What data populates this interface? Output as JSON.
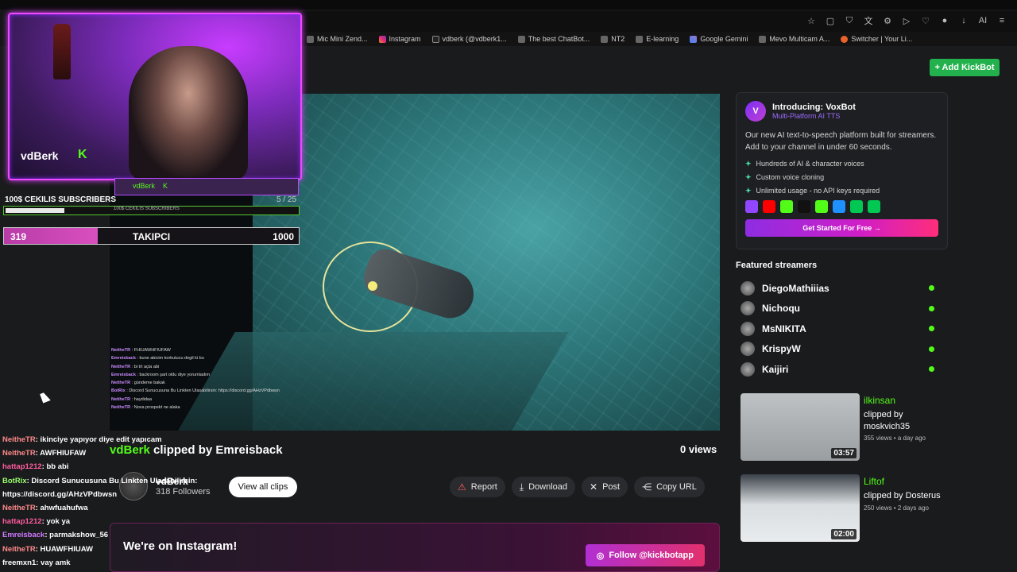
{
  "browser": {
    "bookmarks": [
      {
        "label": "Mic Mini Zend...",
        "icon": "generic"
      },
      {
        "label": "Instagram",
        "icon": "instagram"
      },
      {
        "label": "vdberk (@vdberk1...",
        "icon": "tiktok"
      },
      {
        "label": "The best ChatBot...",
        "icon": "generic"
      },
      {
        "label": "NT2",
        "icon": "generic"
      },
      {
        "label": "E-learning",
        "icon": "generic"
      },
      {
        "label": "Google Gemini",
        "icon": "gemini"
      },
      {
        "label": "Mevo Multicam A...",
        "icon": "generic"
      },
      {
        "label": "Switcher | Your Li...",
        "icon": "switcher"
      }
    ],
    "toolbar_ai_label": "AI"
  },
  "header": {
    "add_kickbot_label": "+ Add KickBot"
  },
  "clip": {
    "channel": "vdBerk",
    "clipped_by_text": "clipped by Emreisback",
    "views": "0 views",
    "channel_name": "vdBerk",
    "followers": "318 Followers",
    "view_all_label": "View all clips",
    "actions": {
      "report": "Report",
      "download": "Download",
      "post": "Post",
      "copy_url": "Copy URL"
    }
  },
  "promo": {
    "title": "We're on Instagram!",
    "follow_label": "Follow @kickbotapp"
  },
  "voxbot": {
    "logo": "V",
    "title": "Introducing: VoxBot",
    "subtitle": "Multi-Platform AI TTS",
    "description": "Our new AI text-to-speech platform built for streamers. Add to your channel in under 60 seconds.",
    "features": [
      "Hundreds of AI & character voices",
      "Custom voice cloning",
      "Unlimited usage - no API keys required"
    ],
    "cta": "Get Started For Free →",
    "platform_colors": [
      "#9146ff",
      "#ff0000",
      "#53fc18",
      "#111111",
      "#53fc18",
      "#1e90ff",
      "#00c853",
      "#00c853"
    ]
  },
  "featured": {
    "title": "Featured streamers",
    "streamers": [
      "DiegoMathiiias",
      "Nichoqu",
      "MsNIKITA",
      "KrispyW",
      "Kaijiri"
    ]
  },
  "clips": [
    {
      "channel": "ilkinsan",
      "by": "clipped by moskvich35",
      "meta": "355 views • a day ago",
      "duration": "03:57"
    },
    {
      "channel": "Liftof",
      "by": "clipped by Dosterus",
      "meta": "250 views • 2 days ago",
      "duration": "02:00"
    }
  ],
  "overlay": {
    "cam_name": "vdBerk",
    "mini_cam_name": "vdBerk",
    "subs_label": "100$ CEKILIS SUBSCRIBERS",
    "subs_count": "5 / 25",
    "subs_inner": "100$ CEKILIS SUBSCRIBERS",
    "subs_progress": 0.2,
    "follow_current": "319",
    "follow_label": "TAKIPCI",
    "follow_goal": "1000",
    "follow_progress": 0.319
  },
  "video_chat": [
    {
      "user": "NeitheTR",
      "msg": ": FHIUAWHFIUFAW"
    },
    {
      "user": "Emreisback",
      "msg": ": bune abicim korkutucu degil ki bu"
    },
    {
      "user": "NeitheTR",
      "msg": ": bi trt açta abi"
    },
    {
      "user": "Emreisback",
      "msg": ": backroom şart oldu diye yorumladım"
    },
    {
      "user": "NeitheTR",
      "msg": ": gündeme bakak"
    },
    {
      "user": "BotRix",
      "msg": ": Discord Sunucusuna Bu Linkten Ulasabilirsin: https://discord.gg/AHzVPdbwsn"
    },
    {
      "user": "NeitheTR",
      "msg": ": haydidaa"
    },
    {
      "user": "NeitheTR",
      "msg": ": Nova prospekt ne alaka"
    }
  ],
  "chat": [
    {
      "user": "NeitheTR",
      "msg": ": ikinciye yapıyor diye edit yapıcam",
      "cls": "u1"
    },
    {
      "user": "NeitheTR",
      "msg": ": AWFHIUFAW",
      "cls": "u1"
    },
    {
      "user": "hattap1212",
      "msg": ": bb abi",
      "cls": "u2"
    },
    {
      "user": "BotRix",
      "msg": ": Discord Sunucusuna Bu Linkten Ulasabilirsin:",
      "cls": "u3"
    },
    {
      "user": "",
      "msg": "https://discord.gg/AHzVPdbwsn",
      "cls": "u5"
    },
    {
      "user": "NeitheTR",
      "msg": ": ahwfuahufwa",
      "cls": "u1"
    },
    {
      "user": "hattap1212",
      "msg": ": yok ya",
      "cls": "u2"
    },
    {
      "user": "Emreisback",
      "msg": ": parmakshow_56",
      "cls": "u4"
    },
    {
      "user": "NeitheTR",
      "msg": ": HUAWFHIUAW",
      "cls": "u1"
    },
    {
      "user": "freemxn1",
      "msg": ": vay amk",
      "cls": "u5"
    }
  ]
}
